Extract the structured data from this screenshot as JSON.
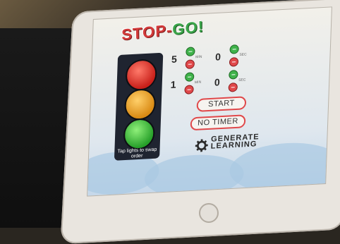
{
  "app": {
    "logo_left": "STOP",
    "logo_dash": "-",
    "logo_right": "GO!"
  },
  "traffic_light": {
    "caption": "Tap lights to swap order"
  },
  "timers": [
    {
      "minutes": "5",
      "seconds": "0",
      "min_unit": "MIN",
      "sec_unit": "SEC"
    },
    {
      "minutes": "1",
      "seconds": "0",
      "min_unit": "MIN",
      "sec_unit": "SEC"
    }
  ],
  "buttons": {
    "start": "START",
    "no_timer": "NO TIMER"
  },
  "brand": {
    "line1": "GENERATE",
    "line2": "LEARNING"
  },
  "colors": {
    "red": "#d23a3a",
    "green": "#3ba54a",
    "amber": "#d98a14",
    "pill_border": "#e0484a"
  }
}
